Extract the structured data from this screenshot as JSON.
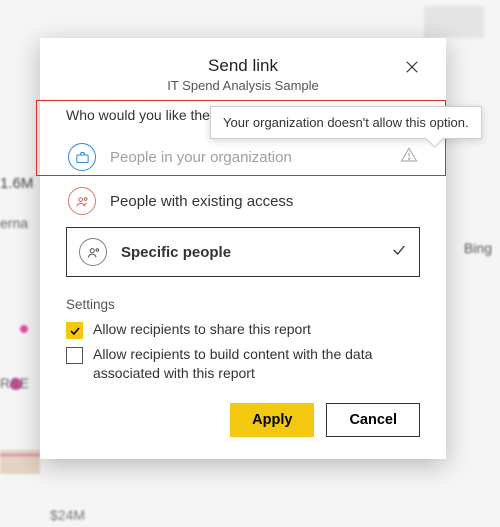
{
  "dialog": {
    "title": "Send link",
    "subtitle": "IT Spend Analysis Sample",
    "prompt": "Who would you like the lin'",
    "options": {
      "org": "People in your organization",
      "existing": "People with existing access",
      "specific": "Specific people"
    },
    "tooltip": "Your organization doesn't allow this option.",
    "settings_title": "Settings",
    "settings": {
      "share": "Allow recipients to share this report",
      "build": "Allow recipients to build content with the data associated with this report"
    },
    "buttons": {
      "apply": "Apply",
      "cancel": "Cancel"
    }
  },
  "bg": {
    "val1": "1.6M",
    "val2": "erna",
    "bing": "Bing",
    "rd": "R&E",
    "val3": "$24M"
  }
}
